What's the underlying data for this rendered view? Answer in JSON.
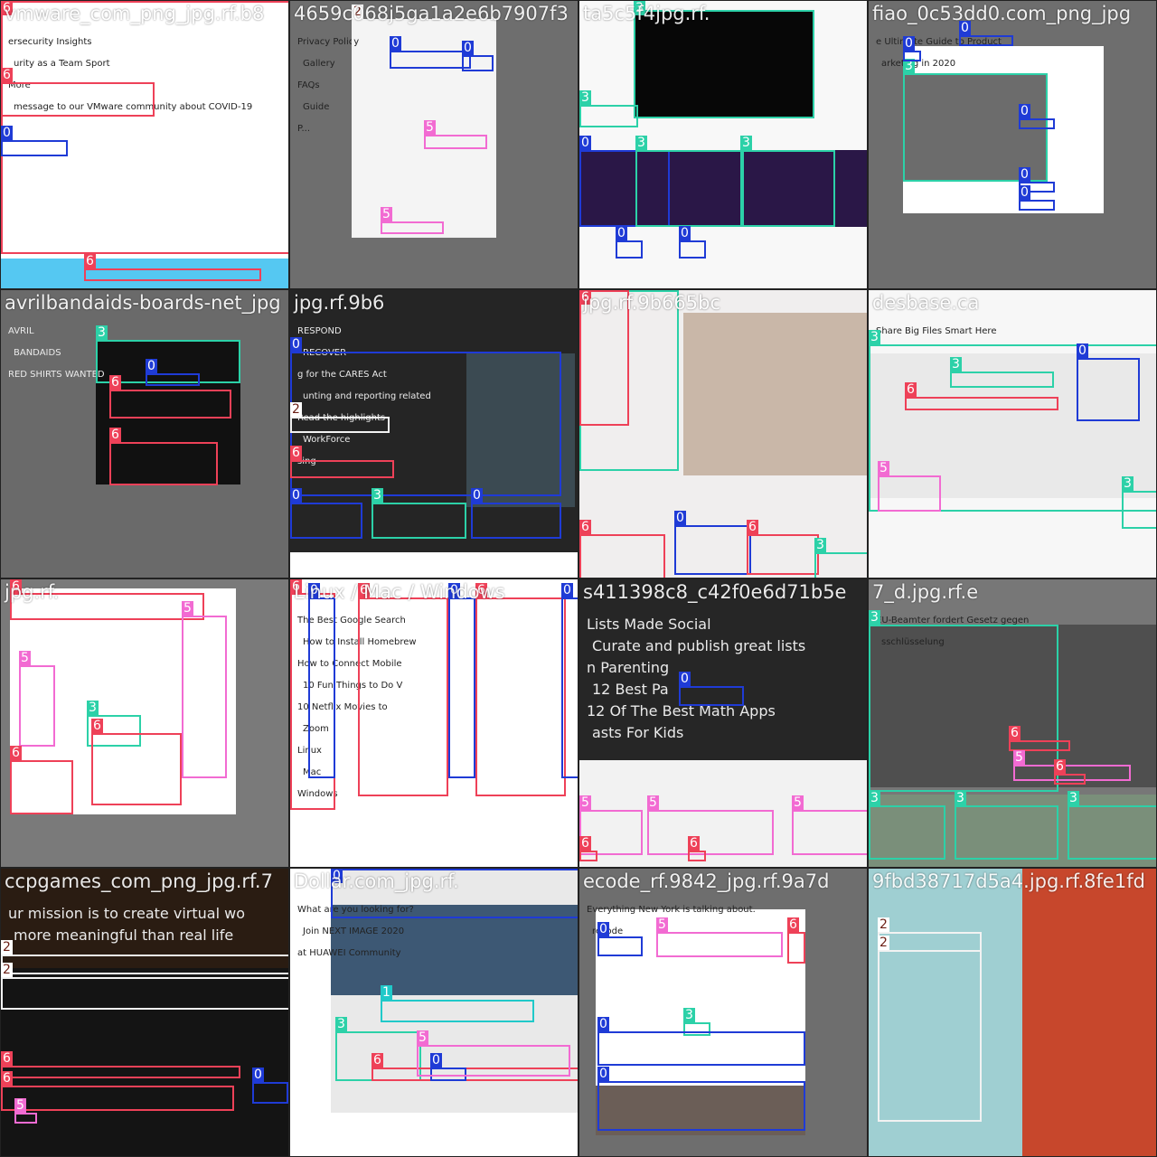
{
  "mosaic": {
    "tiles": [
      {
        "filename": "vmware_com_png_jpg.rf.b8",
        "lines": [
          "ersecurity Insights",
          "urity as a Team Sport",
          "More",
          "message to our VMware community about COVID-19"
        ]
      },
      {
        "filename": "4659c068j5ga1a2e6b7907f3",
        "lines": [
          "Privacy Policy",
          "Gallery",
          "FAQs",
          "Guide",
          "P..."
        ]
      },
      {
        "filename": "ta5c5f4jpg.rf.",
        "lines": []
      },
      {
        "filename": "fiao_0c53dd0.com_png_jpg",
        "lines": [
          "e Ultimate Guide to Product",
          "arketing in 2020"
        ]
      },
      {
        "filename": "avrilbandaids-boards-net_jpg",
        "lines": [
          "AVRIL",
          "BANDAIDS",
          "RED SHIRTS WANTED"
        ]
      },
      {
        "filename": "jpg.rf.9b6",
        "lines": [
          "RESPOND",
          "RECOVER",
          "g for the CARES Act",
          "unting and reporting related",
          "Read the highlights",
          "WorkForce",
          "sing"
        ]
      },
      {
        "filename": "jpg.rf.9b665bc",
        "lines": []
      },
      {
        "filename": "desbase.ca",
        "lines": [
          "Share Big Files Smart Here"
        ]
      },
      {
        "filename": "jpg.rf.",
        "lines": []
      },
      {
        "filename": "Linux / Mac / Windows",
        "lines": [
          "The Best Google Search",
          "How to Install Homebrew",
          "How to Connect Mobile",
          "10 Fun Things to Do V",
          "10 Netflix Movies to",
          "Zoom",
          "Linux",
          "Mac",
          "Windows"
        ]
      },
      {
        "filename": "s411398c8_c42f0e6d71b5e",
        "lines": [
          "Lists Made Social",
          "Curate and publish great lists",
          "n Parenting",
          "12 Best Pa",
          "12 Of The Best Math Apps",
          "asts For Kids"
        ]
      },
      {
        "filename": "7_d.jpg.rf.e",
        "lines": [
          "EU-Beamter fordert Gesetz gegen",
          "sschlüsselung"
        ]
      },
      {
        "filename": "ccpgames_com_png_jpg.rf.7",
        "lines": [
          "ur mission is to create virtual wo",
          "more meaningful than real life"
        ]
      },
      {
        "filename": "Dollar.com_jpg.rf.",
        "lines": [
          "What are you looking for?",
          "Join NEXT IMAGE 2020",
          "at HUAWEI Community"
        ]
      },
      {
        "filename": "ecode_rf.9842_jpg.rf.9a7d",
        "lines": [
          "Everything New York is talking about.",
          "recode"
        ]
      },
      {
        "filename": "9fbd38717d5a4.jpg.rf.8fe1fd",
        "lines": []
      }
    ],
    "label_legend": [
      "0",
      "1",
      "2",
      "3",
      "5",
      "6"
    ],
    "colors": {
      "0": "#1f3bd6",
      "1": "#20c9c9",
      "2": "#f2f2f2",
      "3": "#2cd1a8",
      "5": "#f26bd2",
      "6": "#ee4158"
    }
  }
}
